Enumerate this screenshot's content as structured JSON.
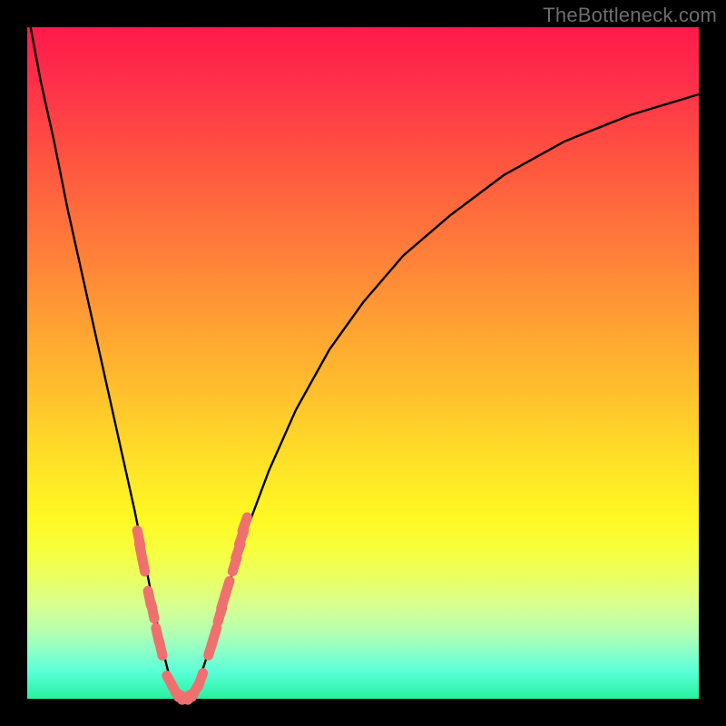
{
  "watermark": "TheBottleneck.com",
  "chart_data": {
    "type": "line",
    "title": "",
    "xlabel": "",
    "ylabel": "",
    "xlim": [
      0,
      100
    ],
    "ylim": [
      0,
      100
    ],
    "grid": false,
    "legend": false,
    "series": [
      {
        "name": "bottleneck-curve",
        "color": "#000000",
        "x": [
          0.5,
          2,
          4,
          6,
          8,
          10,
          12,
          14,
          16,
          18,
          19,
          20,
          21,
          22,
          23,
          24,
          25,
          26,
          28,
          30,
          33,
          36,
          40,
          45,
          50,
          56,
          63,
          71,
          80,
          90,
          100
        ],
        "y": [
          100,
          92,
          83,
          73,
          64,
          55,
          46,
          37,
          28,
          18,
          13,
          8,
          4,
          1.5,
          0.3,
          0.3,
          1.5,
          4,
          10,
          17,
          26,
          34,
          43,
          52,
          59,
          66,
          72,
          78,
          83,
          87,
          90
        ]
      }
    ],
    "markers": [
      {
        "name": "cluster-left-upper",
        "color": "#f07070",
        "shape": "rounded-dash",
        "points": [
          {
            "x": 16.6,
            "y": 24
          },
          {
            "x": 16.9,
            "y": 22
          },
          {
            "x": 17.3,
            "y": 20
          }
        ]
      },
      {
        "name": "cluster-left-mid",
        "color": "#f07070",
        "shape": "rounded-dash",
        "points": [
          {
            "x": 18.2,
            "y": 15
          },
          {
            "x": 18.7,
            "y": 13
          }
        ]
      },
      {
        "name": "cluster-left-lower",
        "color": "#f07070",
        "shape": "rounded-dash",
        "points": [
          {
            "x": 19.4,
            "y": 9.5
          },
          {
            "x": 19.9,
            "y": 7.5
          }
        ]
      },
      {
        "name": "cluster-bottom",
        "color": "#f07070",
        "shape": "rounded-dash",
        "points": [
          {
            "x": 21.3,
            "y": 2.5
          },
          {
            "x": 22.0,
            "y": 1.2
          },
          {
            "x": 23.0,
            "y": 0.4
          },
          {
            "x": 24.0,
            "y": 0.4
          },
          {
            "x": 25.0,
            "y": 1.2
          },
          {
            "x": 25.8,
            "y": 2.8
          }
        ]
      },
      {
        "name": "cluster-right-lower",
        "color": "#f07070",
        "shape": "rounded-dash",
        "points": [
          {
            "x": 27.3,
            "y": 7.5
          },
          {
            "x": 27.9,
            "y": 9.5
          }
        ]
      },
      {
        "name": "cluster-right-mid",
        "color": "#f07070",
        "shape": "rounded-dash",
        "points": [
          {
            "x": 28.7,
            "y": 12.5
          },
          {
            "x": 29.2,
            "y": 14.5
          },
          {
            "x": 29.8,
            "y": 16.5
          }
        ]
      },
      {
        "name": "cluster-right-upper",
        "color": "#f07070",
        "shape": "rounded-dash",
        "points": [
          {
            "x": 30.9,
            "y": 20
          },
          {
            "x": 31.4,
            "y": 22
          },
          {
            "x": 31.9,
            "y": 24
          },
          {
            "x": 32.4,
            "y": 26
          }
        ]
      }
    ],
    "background": {
      "type": "vertical-gradient",
      "stops": [
        {
          "pos": 0.0,
          "color": "#ff1a4b"
        },
        {
          "pos": 0.5,
          "color": "#ffc22d"
        },
        {
          "pos": 0.75,
          "color": "#fff823"
        },
        {
          "pos": 1.0,
          "color": "#27f29f"
        }
      ]
    }
  }
}
